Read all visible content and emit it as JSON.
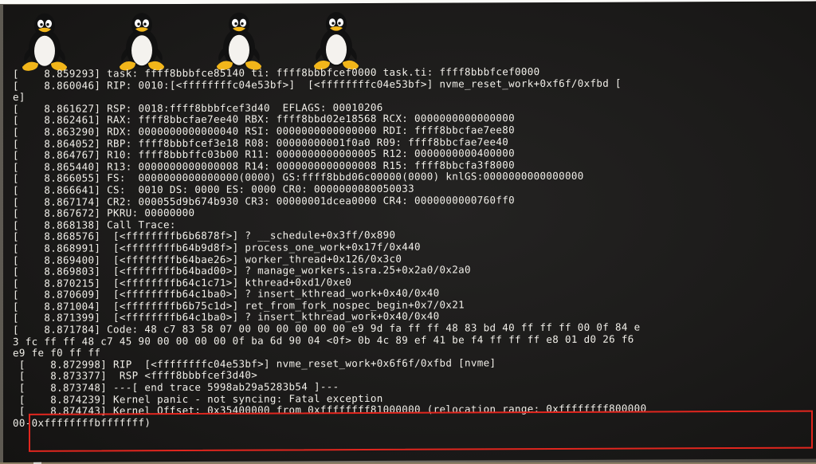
{
  "window": {
    "title": ""
  },
  "boot_logo": {
    "icon": "tux-penguin-icon",
    "count": 4
  },
  "console": {
    "lines": [
      "[    8.859293] task: ffff8bbbfce85140 ti: ffff8bbbfcef0000 task.ti: ffff8bbbfcef0000",
      "[    8.860046] RIP: 0010:[<ffffffffc04e53bf>]  [<ffffffffc04e53bf>] nvme_reset_work+0xf6f/0xfbd [",
      "e]",
      "[    8.861627] RSP: 0018:ffff8bbbfcef3d40  EFLAGS: 00010206",
      "[    8.862461] RAX: ffff8bbcfae7ee40 RBX: ffff8bbd02e18568 RCX: 0000000000000000",
      "[    8.863290] RDX: 0000000000000040 RSI: 0000000000000000 RDI: ffff8bbcfae7ee80",
      "[    8.864052] RBP: ffff8bbbfcef3e18 R08: 00000000001f0a0 R09: ffff8bbcfae7ee40",
      "[    8.864767] R10: ffff8bbbffc03b00 R11: 0000000000000005 R12: 0000000000400000",
      "[    8.865440] R13: 0000000000000008 R14: 0000000000000008 R15: ffff8bbcfa3f8000",
      "[    8.866055] FS:  0000000000000000(0000) GS:ffff8bbd06c00000(0000) knlGS:0000000000000000",
      "[    8.866641] CS:  0010 DS: 0000 ES: 0000 CR0: 0000000080050033",
      "[    8.867174] CR2: 000055d9b674b930 CR3: 00000001dcea0000 CR4: 0000000000760ff0",
      "[    8.867672] PKRU: 00000000",
      "[    8.868138] Call Trace:",
      "[    8.868576]  [<ffffffffb6b6878f>] ? __schedule+0x3ff/0x890",
      "[    8.868991]  [<ffffffffb64b9d8f>] process_one_work+0x17f/0x440",
      "[    8.869400]  [<ffffffffb64bae26>] worker_thread+0x126/0x3c0",
      "[    8.869803]  [<ffffffffb64bad00>] ? manage_workers.isra.25+0x2a0/0x2a0",
      "[    8.870215]  [<ffffffffb64c1c71>] kthread+0xd1/0xe0",
      "[    8.870609]  [<ffffffffb64c1ba0>] ? insert_kthread_work+0x40/0x40",
      "[    8.871004]  [<ffffffffb6b75c1d>] ret_from_fork_nospec_begin+0x7/0x21",
      "[    8.871399]  [<ffffffffb64c1ba0>] ? insert_kthread_work+0x40/0x40",
      "[    8.871784] Code: 48 c7 83 58 07 00 00 00 00 00 00 e9 9d fa ff ff 48 83 bd 40 ff ff ff 00 0f 84 e",
      "3 fc ff ff 48 c7 45 90 00 00 00 00 0f ba 6d 90 04 <0f> 0b 4c 89 ef 41 be f4 ff ff ff e8 01 d0 26 f6",
      "e9 fe f0 ff ff",
      " [    8.872998] RIP  [<ffffffffc04e53bf>] nvme_reset_work+0x6f6f/0xfbd [nvme]",
      " [    8.873377]  RSP <ffff8bbbfcef3d40>",
      " [    8.873748] ---[ end trace 5998ab29a5283b54 ]---",
      " [    8.874239] Kernel panic - not syncing: Fatal exception",
      " [    8.874743] Kernel Offset: 0x35400000 from 0xffffffff81000000 (relocation range: 0xffffffff800000",
      "00-0xffffffffbfffffff)"
    ]
  },
  "highlight": {
    "color": "#e1261e"
  }
}
